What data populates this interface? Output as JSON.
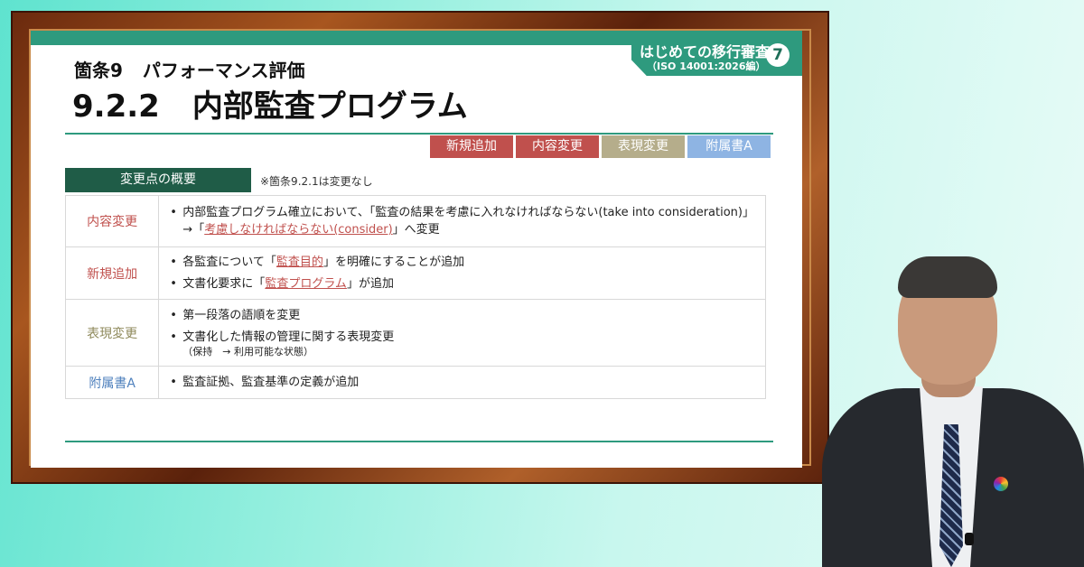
{
  "series": {
    "title": "はじめての移行審査",
    "subtitle": "（ISO 14001:2026編）",
    "number": "7"
  },
  "clause": {
    "number": "箇条9",
    "name": "パフォーマンス評価"
  },
  "heading": {
    "number": "9.2.2",
    "name": "内部監査プログラム"
  },
  "legend": {
    "new": "新規追加",
    "content": "内容変更",
    "expression": "表現変更",
    "annex": "附属書A"
  },
  "summary": {
    "label": "変更点の概要",
    "note": "※箇条9.2.1は変更なし"
  },
  "rows": {
    "content_change": {
      "category": "内容変更",
      "item1_line1": "内部監査プログラム確立において、「監査の結果を考慮に入れなければならない(take into consideration)」",
      "item1_line2_prefix": "→「",
      "item1_line2_highlight": "考慮しなければならない(consider)",
      "item1_line2_suffix": "」へ変更"
    },
    "new_addition": {
      "category": "新規追加",
      "item1_prefix": "各監査について「",
      "item1_highlight": "監査目的",
      "item1_suffix": "」を明確にすることが追加",
      "item2_prefix": "文書化要求に「",
      "item2_highlight": "監査プログラム",
      "item2_suffix": "」が追加"
    },
    "expression_change": {
      "category": "表現変更",
      "item1": "第一段落の語順を変更",
      "item2": "文書化した情報の管理に関する表現変更",
      "item2_note": "（保持　→ 利用可能な状態）"
    },
    "annex": {
      "category": "附属書A",
      "item1": "監査証拠、監査基準の定義が追加"
    }
  },
  "colors": {
    "accent_green": "#2e9a7e",
    "dark_green": "#1f5c47",
    "red": "#c0504d",
    "khaki": "#b5ad8b",
    "light_blue": "#8eb4e3",
    "frame_brown": "#6b2a0e"
  }
}
